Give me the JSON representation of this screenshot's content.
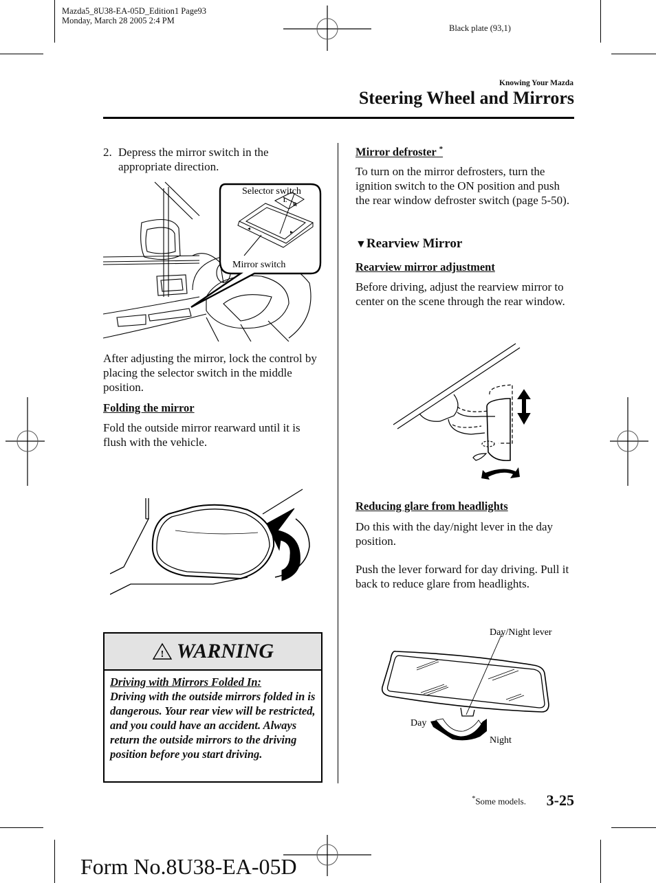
{
  "slug": {
    "line1": "Mazda5_8U38-EA-05D_Edition1 Page93",
    "line2": "Monday, March 28 2005 2:4 PM"
  },
  "plate": "Black plate (93,1)",
  "header": {
    "section": "Knowing Your Mazda",
    "title": "Steering Wheel and Mirrors"
  },
  "left_column": {
    "step2_num": "2.",
    "step2_text": "Depress the mirror switch in the appropriate direction.",
    "fig1_labels": {
      "selector": "Selector switch",
      "mirror": "Mirror switch",
      "L": "L",
      "R": "R"
    },
    "after_text": "After adjusting the mirror, lock the control by placing the selector switch in the middle position.",
    "folding_heading": "Folding the mirror",
    "folding_text": "Fold the outside mirror rearward until it is flush with the vehicle."
  },
  "warning": {
    "title": "WARNING",
    "subheading": "Driving with Mirrors Folded In:",
    "text": "Driving with the outside mirrors folded in is dangerous. Your rear view will be restricted, and you could have an accident. Always return the outside mirrors to the driving position before you start driving."
  },
  "right_column": {
    "defroster_heading": "Mirror defroster",
    "defroster_star": "*",
    "defroster_text": "To turn on the mirror defrosters, turn the ignition switch to the ON position and push the rear window defroster switch (page 5-50).",
    "rearview_marker": "▼",
    "rearview_heading": "Rearview Mirror",
    "adjust_heading": "Rearview mirror adjustment",
    "adjust_text": "Before driving, adjust the rearview mirror to center on the scene through the rear window.",
    "glare_heading": "Reducing glare from headlights",
    "glare_text1": "Do this with the day/night lever in the day position.",
    "glare_text2": "Push the lever forward for day driving. Pull it back to reduce glare from headlights.",
    "fig_labels": {
      "lever": "Day/Night lever",
      "day": "Day",
      "night": "Night"
    }
  },
  "footer": {
    "star": "*",
    "note": "Some models.",
    "page": "3-25",
    "form": "Form No.8U38-EA-05D"
  }
}
